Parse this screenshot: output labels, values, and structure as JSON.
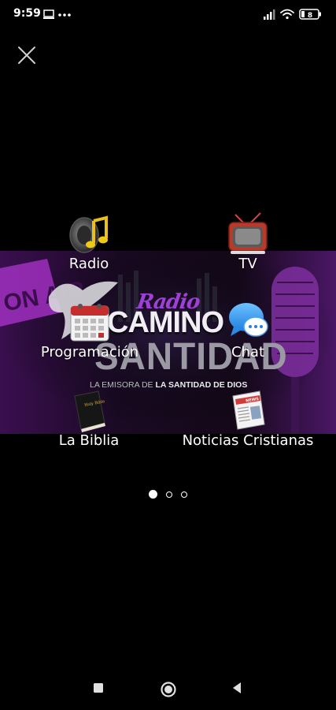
{
  "status_bar": {
    "time": "9:59",
    "battery_level": "8",
    "icons": [
      "screen-icon",
      "more-dots-icon",
      "signal-icon",
      "wifi-icon",
      "battery-icon"
    ]
  },
  "banner": {
    "logo_script": "Radio",
    "logo_title": "CAMINO",
    "logo_subtitle": "SANTIDAD",
    "tagline_prefix": "LA EMISORA DE ",
    "tagline_emphasis": "LA SANTIDAD DE DIOS",
    "on_air": "ON AIR"
  },
  "menu": {
    "items": [
      {
        "label": "Radio",
        "icon": "music-speaker-icon"
      },
      {
        "label": "TV",
        "icon": "tv-icon"
      },
      {
        "label": "Programación",
        "icon": "calendar-icon"
      },
      {
        "label": "Chat",
        "icon": "chat-bubble-icon"
      },
      {
        "label": "La Biblia",
        "icon": "bible-icon"
      },
      {
        "label": "Noticias Cristianas",
        "icon": "newspaper-icon"
      }
    ],
    "bible_cover_text": "Holy Bible",
    "newspaper_header": "NEWS"
  },
  "pager": {
    "count": 3,
    "active_index": 0
  },
  "nav_bar": {
    "buttons": [
      "recent-apps-icon",
      "home-icon",
      "back-icon"
    ]
  },
  "colors": {
    "background": "#000000",
    "accent_purple": "#9e3fd6",
    "banner_purple": "#5a1a78",
    "text": "#ffffff"
  }
}
